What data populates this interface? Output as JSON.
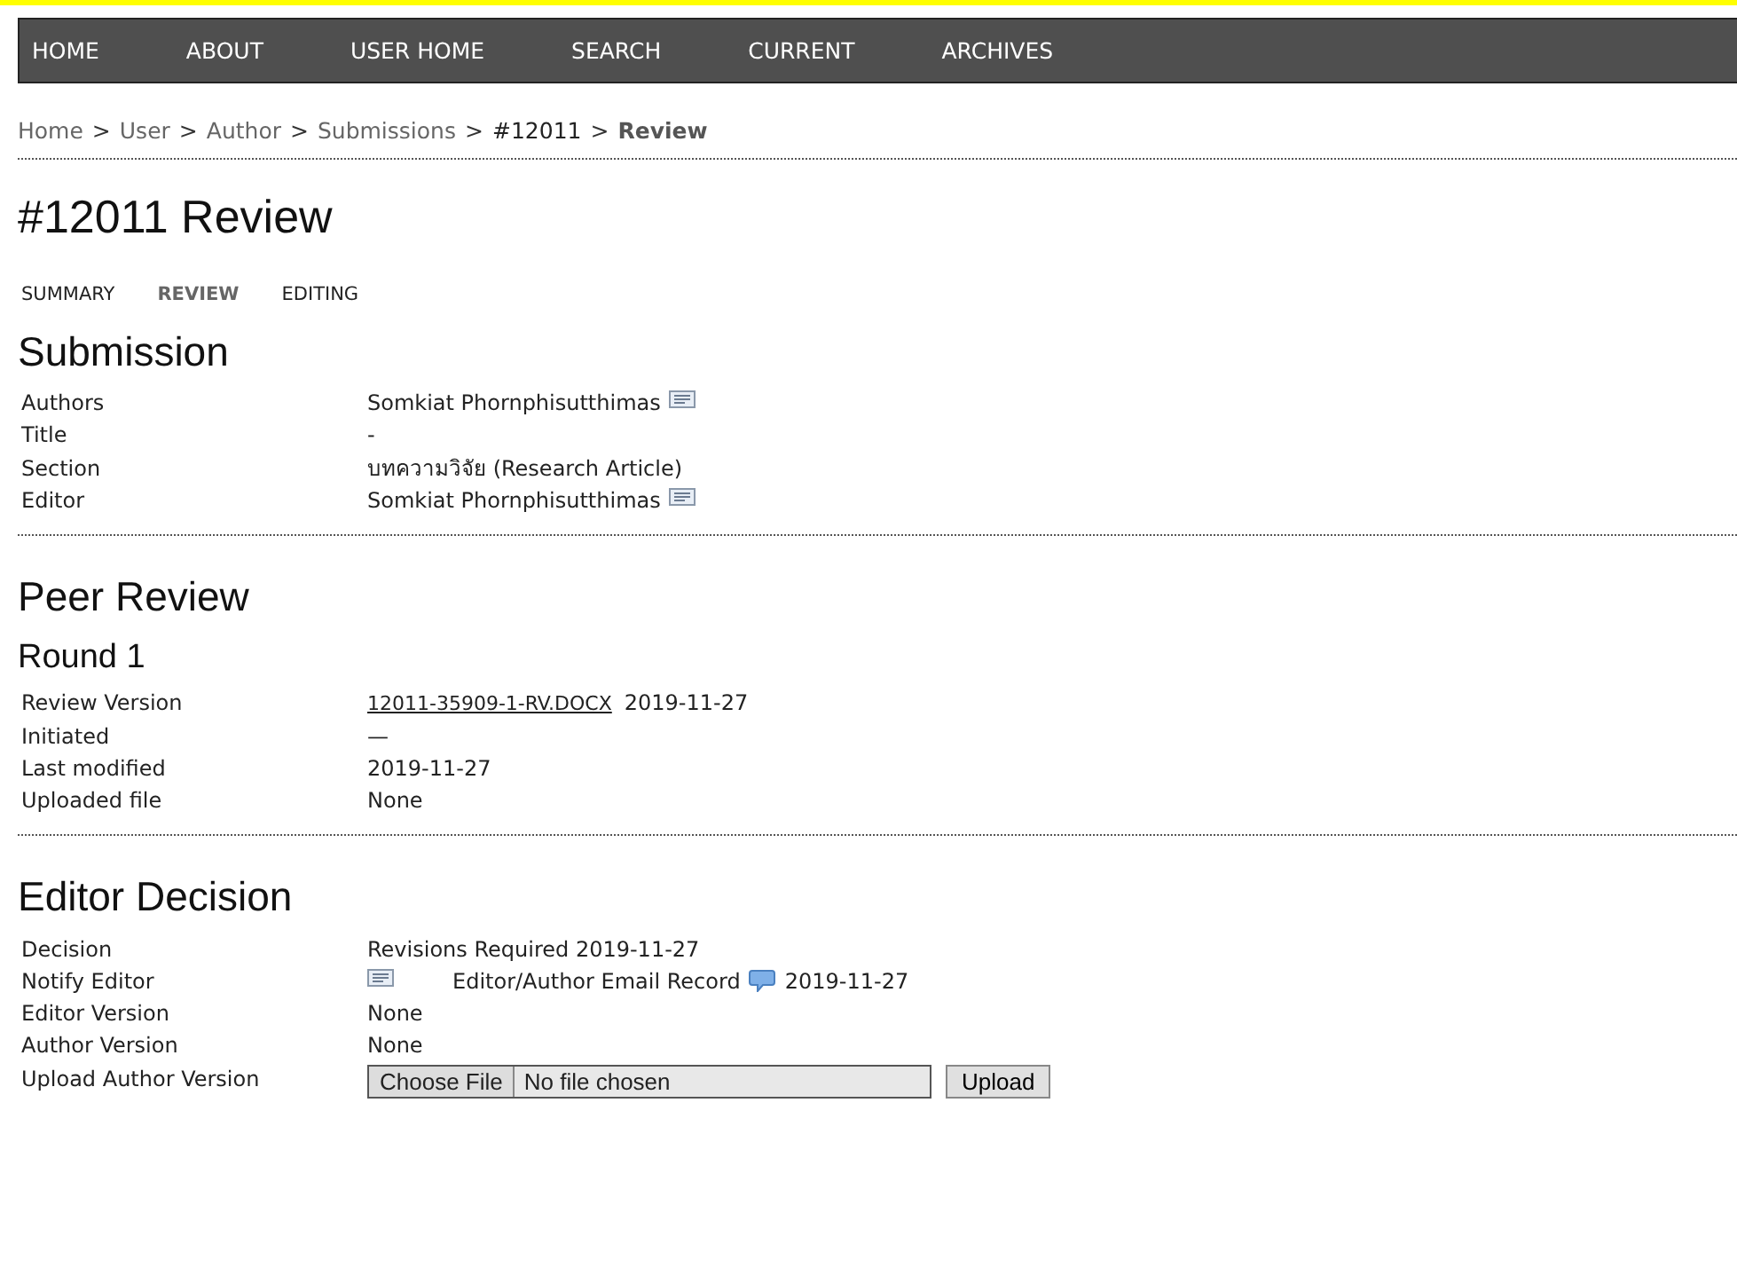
{
  "nav": [
    "HOME",
    "ABOUT",
    "USER HOME",
    "SEARCH",
    "CURRENT",
    "ARCHIVES"
  ],
  "breadcrumb": {
    "separator": ">",
    "items": [
      {
        "text": "Home",
        "kind": "link"
      },
      {
        "text": "User",
        "kind": "link"
      },
      {
        "text": "Author",
        "kind": "link"
      },
      {
        "text": "Submissions",
        "kind": "link"
      },
      {
        "text": "#12011",
        "kind": "plain"
      },
      {
        "text": "Review",
        "kind": "current"
      }
    ]
  },
  "title": "#12011 Review",
  "tabs": [
    {
      "label": "SUMMARY",
      "selected": false
    },
    {
      "label": "REVIEW",
      "selected": true
    },
    {
      "label": "EDITING",
      "selected": false
    }
  ],
  "sections": [
    {
      "heading": "Submission",
      "rows": [
        {
          "label": "Authors",
          "kind": "person",
          "value": "Somkiat Phornphisutthimas"
        },
        {
          "label": "Title",
          "kind": "text",
          "value": "-"
        },
        {
          "label": "Section",
          "kind": "text",
          "value": "บทความวิจัย (Research Article)"
        },
        {
          "label": "Editor",
          "kind": "person",
          "value": "Somkiat Phornphisutthimas"
        }
      ]
    },
    {
      "heading": "Peer Review",
      "subheading": "Round 1",
      "rows": [
        {
          "label": "Review Version",
          "kind": "file",
          "file": "12011-35909-1-RV.DOCX",
          "date": "2019-11-27"
        },
        {
          "label": "Initiated",
          "kind": "text",
          "value": "—"
        },
        {
          "label": "Last modified",
          "kind": "text",
          "value": "2019-11-27"
        },
        {
          "label": "Uploaded file",
          "kind": "text",
          "value": "None"
        }
      ]
    },
    {
      "heading": "Editor Decision",
      "rows": [
        {
          "label": "Decision",
          "kind": "text",
          "value": "Revisions Required 2019-11-27"
        },
        {
          "label": "Notify Editor",
          "kind": "notify",
          "record": "Editor/Author Email Record",
          "date": "2019-11-27"
        },
        {
          "label": "Editor Version",
          "kind": "text",
          "value": "None"
        },
        {
          "label": "Author Version",
          "kind": "text",
          "value": "None"
        },
        {
          "label": "Upload Author Version",
          "kind": "upload",
          "button": "Choose File",
          "status": "No file chosen",
          "action": "Upload"
        }
      ]
    }
  ]
}
